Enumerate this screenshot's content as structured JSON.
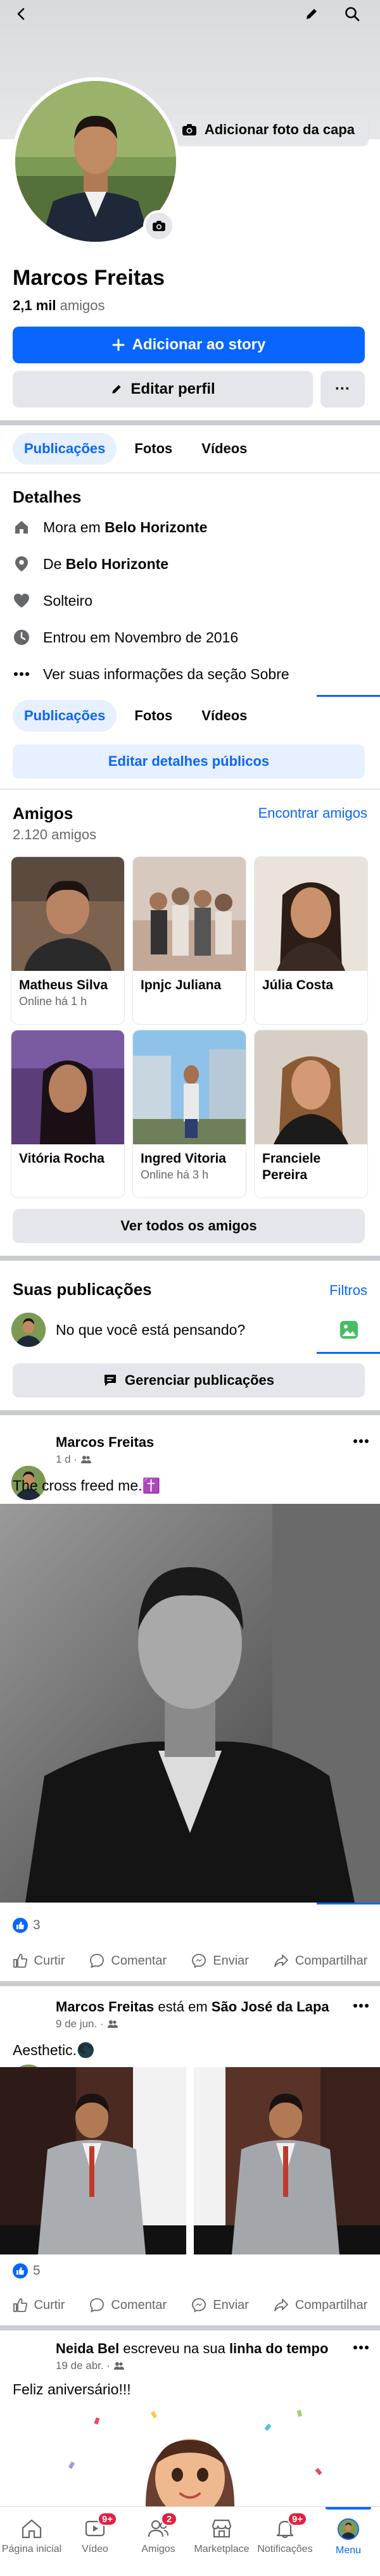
{
  "profile": {
    "name": "Marcos Freitas",
    "friends_count": "2,1 mil",
    "friends_suffix": "amigos",
    "add_cover_label": "Adicionar foto da capa",
    "add_story_label": "Adicionar ao story",
    "edit_profile_label": "Editar perfil",
    "more_label": "···"
  },
  "tabs": [
    {
      "label": "Publicações"
    },
    {
      "label": "Fotos"
    },
    {
      "label": "Vídeos"
    }
  ],
  "details": {
    "title": "Detalhes",
    "items": [
      {
        "icon": "home-icon",
        "prefix": "Mora em ",
        "bold": "Belo Horizonte"
      },
      {
        "icon": "location-pin-icon",
        "prefix": "De ",
        "bold": "Belo Horizonte"
      },
      {
        "icon": "heart-icon",
        "prefix": "Solteiro",
        "bold": ""
      },
      {
        "icon": "clock-icon",
        "prefix": "Entrou em Novembro de 2016",
        "bold": ""
      },
      {
        "icon": "more-dots-icon",
        "prefix": "Ver suas informações da seção Sobre",
        "bold": ""
      }
    ],
    "edit_public_label": "Editar detalhes públicos"
  },
  "friends": {
    "title": "Amigos",
    "count": "2.120 amigos",
    "find_label": "Encontrar amigos",
    "see_all_label": "Ver todos os amigos",
    "items": [
      {
        "name": "Matheus Silva",
        "status": "Online há 1 h"
      },
      {
        "name": "Ipnjc Juliana",
        "status": ""
      },
      {
        "name": "Júlia Costa",
        "status": ""
      },
      {
        "name": "Vitória Rocha",
        "status": ""
      },
      {
        "name": "Ingred Vitoria",
        "status": "Online há 3 h"
      },
      {
        "name": "Franciele Pereira",
        "status": ""
      }
    ]
  },
  "posts_section": {
    "title": "Suas publicações",
    "filters_label": "Filtros",
    "composer_placeholder": "No que você está pensando?",
    "manage_label": "Gerenciar publicações"
  },
  "posts": [
    {
      "author": "Marcos Freitas",
      "meta": "1 d ·",
      "text": "The cross freed me.✝️",
      "reactions": "3"
    },
    {
      "author": "Marcos Freitas",
      "connector": " está em ",
      "place": "São José da Lapa",
      "meta": "9 de jun. ·",
      "text": "Aesthetic.🌑",
      "reactions": "5"
    },
    {
      "author": "Neida Bel",
      "connector": " escreveu na sua ",
      "place": "linha do tempo",
      "meta": "19 de abr. ·",
      "text": "Feliz aniversário!!!"
    }
  ],
  "actions": {
    "like": "Curtir",
    "comment": "Comentar",
    "send": "Enviar",
    "share": "Compartilhar"
  },
  "bottom_nav": [
    {
      "label": "Página inicial",
      "icon": "home-icon",
      "badge": ""
    },
    {
      "label": "Vídeo",
      "icon": "video-icon",
      "badge": "9+"
    },
    {
      "label": "Amigos",
      "icon": "friends-icon",
      "badge": "2"
    },
    {
      "label": "Marketplace",
      "icon": "marketplace-icon",
      "badge": ""
    },
    {
      "label": "Notificações",
      "icon": "bell-icon",
      "badge": "9+"
    },
    {
      "label": "Menu",
      "icon": "menu-avatar-icon",
      "badge": ""
    }
  ],
  "colors": {
    "accent": "#0866ff",
    "badge": "#e41e3f",
    "secondary_text": "#65676b"
  }
}
